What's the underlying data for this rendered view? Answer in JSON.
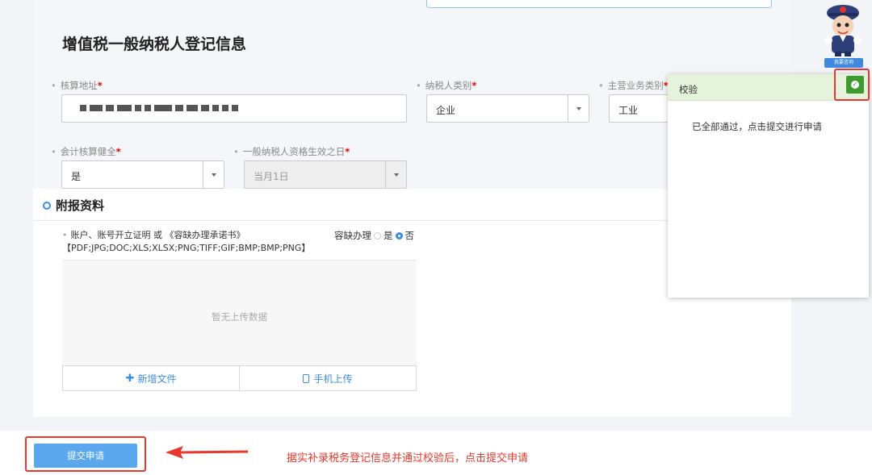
{
  "form": {
    "title": "增值税一般纳税人登记信息",
    "fields": {
      "accounting_address": {
        "label": "核算地址"
      },
      "taxpayer_type": {
        "label": "纳税人类别",
        "value": "企业"
      },
      "main_business": {
        "label": "主营业务类别",
        "value": "工业"
      },
      "accounting_sound": {
        "label": "会计核算健全",
        "value": "是"
      },
      "effective_date": {
        "label": "一般纳税人资格生效之日",
        "value": "当月1日"
      }
    },
    "required_mark": "*",
    "bullet": "•"
  },
  "attachments": {
    "title": "附报资料",
    "doc": {
      "label": "账户、账号开立证明 或 《容缺办理承诺书》",
      "formats": "【PDF;JPG;DOC;XLS;XLSX;PNG;TIFF;GIF;BMP;BMP;PNG】"
    },
    "deferred": {
      "label": "容缺办理",
      "yes": "是",
      "no": "否",
      "selected": "否"
    },
    "empty_text": "暂无上传数据",
    "add_file": "新增文件",
    "mobile_upload": "手机上传"
  },
  "validation_panel": {
    "title": "校验",
    "message": "已全部通过，点击提交进行申请"
  },
  "mascot": {
    "label": "我要咨询"
  },
  "footer": {
    "submit_label": "提交申请",
    "annotation": "据实补录税务登记信息并通过校验后，点击提交申请"
  },
  "colors": {
    "accent": "#3c8de0",
    "highlight_red": "#e8372b",
    "success_green": "#3f9a30"
  }
}
